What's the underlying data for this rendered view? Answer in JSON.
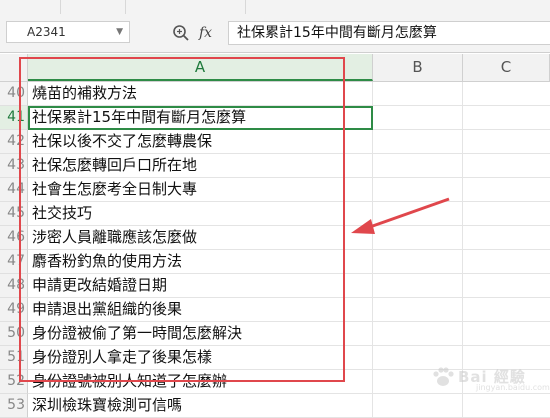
{
  "formula_bar": {
    "name_box": "A2341",
    "fx_label": "fx",
    "formula_text": "社保累計15年中間有斷月怎麼算"
  },
  "columns": [
    "A",
    "B",
    "C"
  ],
  "selected_column": "A",
  "rows": [
    {
      "num": "40",
      "a": "燒苗的補救方法"
    },
    {
      "num": "41",
      "a": "社保累計15年中間有斷月怎麼算",
      "selected": true
    },
    {
      "num": "42",
      "a": "社保以後不交了怎麼轉農保"
    },
    {
      "num": "43",
      "a": "社保怎麼轉回戶口所在地"
    },
    {
      "num": "44",
      "a": "社會生怎麼考全日制大專"
    },
    {
      "num": "45",
      "a": "社交技巧"
    },
    {
      "num": "46",
      "a": "涉密人員離職應該怎麼做"
    },
    {
      "num": "47",
      "a": "麝香粉釣魚的使用方法"
    },
    {
      "num": "48",
      "a": "申請更改結婚證日期"
    },
    {
      "num": "49",
      "a": "申請退出黨組織的後果"
    },
    {
      "num": "50",
      "a": "身份證被偷了第一時間怎麼解決"
    },
    {
      "num": "51",
      "a": "身份證別人拿走了後果怎樣"
    },
    {
      "num": "52",
      "a": "身份證號被別人知道了怎麼辦"
    },
    {
      "num": "53",
      "a": "深圳檢珠寶檢測可信嗎"
    }
  ],
  "annotation": {
    "box_color": "#e0474c",
    "arrow_color": "#e0474c"
  },
  "watermark": {
    "logo_text": "Bai 經驗",
    "sub_text": "jingyan.baidu.com"
  },
  "colors": {
    "selection_green": "#2e8b46",
    "header_bg": "#f2f2f2"
  }
}
